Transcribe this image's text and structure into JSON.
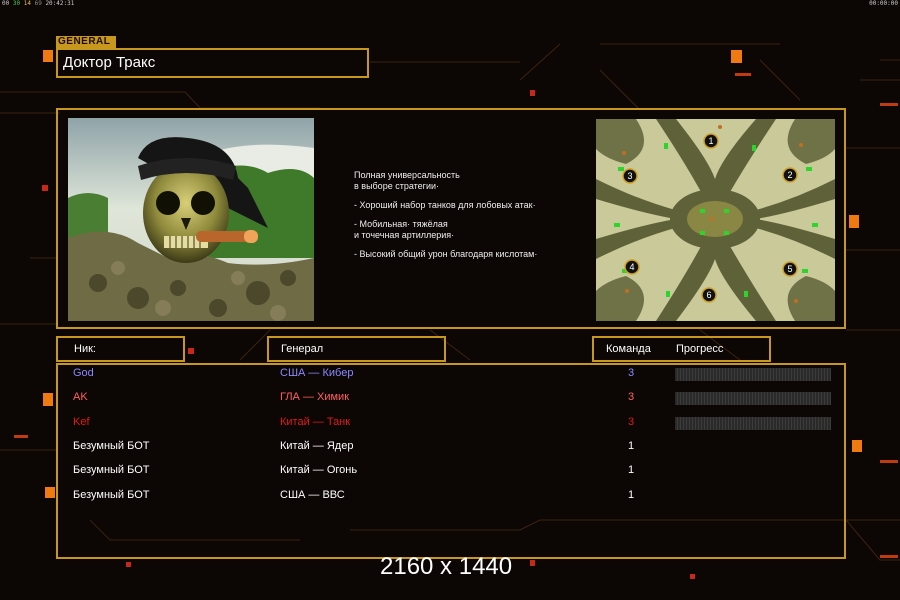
{
  "top_bar": {
    "left_prefix": "00",
    "left_green": "30",
    "left_mid": "14",
    "left_gray": "69",
    "clock": "20:42:31",
    "right_time": "00:00:00"
  },
  "general": {
    "tag": "GENERAL",
    "name": "Доктор Тракс",
    "description": [
      "Полная универсальность",
      "в выборе стратегии·",
      "- Хороший набор танков для лобовых атак·",
      "- Мобильная· тяжёлая",
      "и точечная артиллерия·",
      "- Высокий общий урон благодаря кислотам·"
    ]
  },
  "minimap": {
    "start_positions": [
      "1",
      "2",
      "3",
      "4",
      "5",
      "6"
    ]
  },
  "headers": {
    "nick": "Ник:",
    "general": "Генерал",
    "team": "Команда",
    "progress": "Прогресс"
  },
  "players": [
    {
      "nick": "God",
      "general": "США — Кибер",
      "team": "3",
      "color": "#8a8aff",
      "progress": 0
    },
    {
      "nick": "AK",
      "general": "ГЛА — Химик",
      "team": "3",
      "color": "#ff6060",
      "progress": 0
    },
    {
      "nick": "Kef",
      "general": "Китай — Танк",
      "team": "3",
      "color": "#e21a1a",
      "progress": 0
    },
    {
      "nick": "Безумный БОТ",
      "general": "Китай — Ядер",
      "team": "1",
      "color": "#ffffff"
    },
    {
      "nick": "Безумный БОТ",
      "general": "Китай — Огонь",
      "team": "1",
      "color": "#ffffff"
    },
    {
      "nick": "Безумный БОТ",
      "general": "США — ВВС",
      "team": "1",
      "color": "#ffffff"
    }
  ],
  "watermark": "2160 x 1440",
  "colors": {
    "frame": "#c8981e",
    "background": "#0c0604",
    "accent_orange": "#f07a10"
  }
}
